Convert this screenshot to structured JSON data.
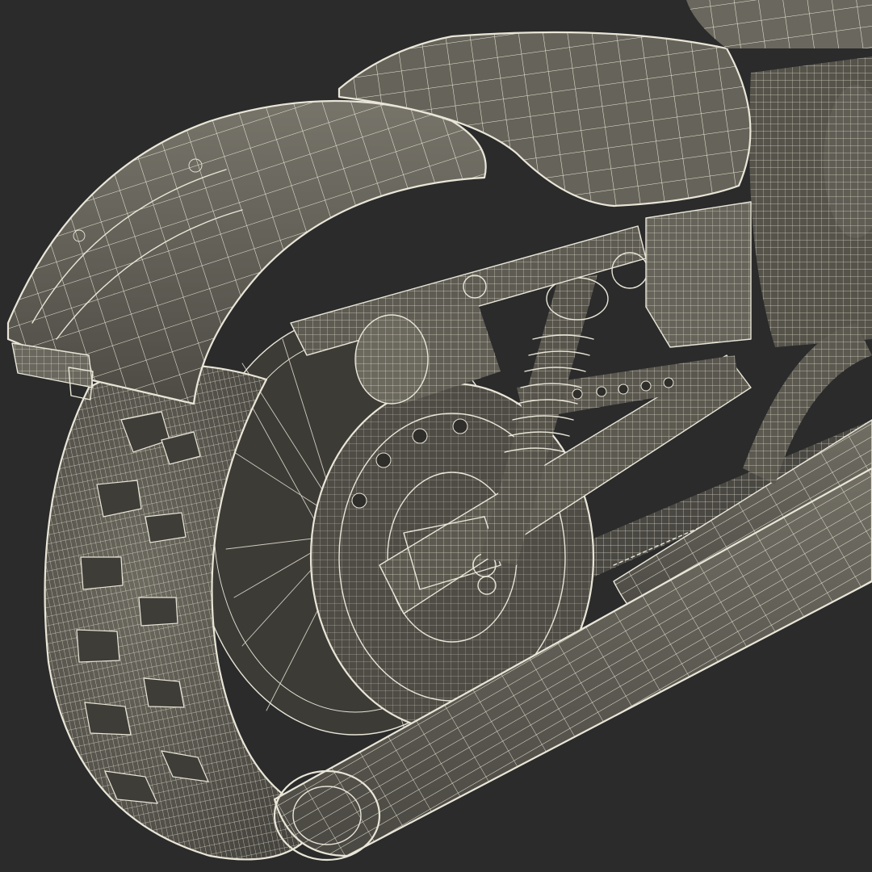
{
  "scene": {
    "subject": "motorcycle-rear",
    "render_style": "wireframe-shaded",
    "colors": {
      "background": "#2b2b2b",
      "shell": "#5f5c53",
      "shell_dark": "#3e3c37",
      "shell_light": "#77746a",
      "wire": "#e9e6d8"
    },
    "parts": [
      "rear-fender-icon",
      "seat-icon",
      "tail-light-icon",
      "rear-tire-icon",
      "spoke-wheel-icon",
      "belt-pulley-icon",
      "shock-absorber-icon",
      "swingarm-icon",
      "turn-signal-icon",
      "exhaust-muffler-icon",
      "engine-block-icon",
      "drive-belt-icon"
    ]
  }
}
